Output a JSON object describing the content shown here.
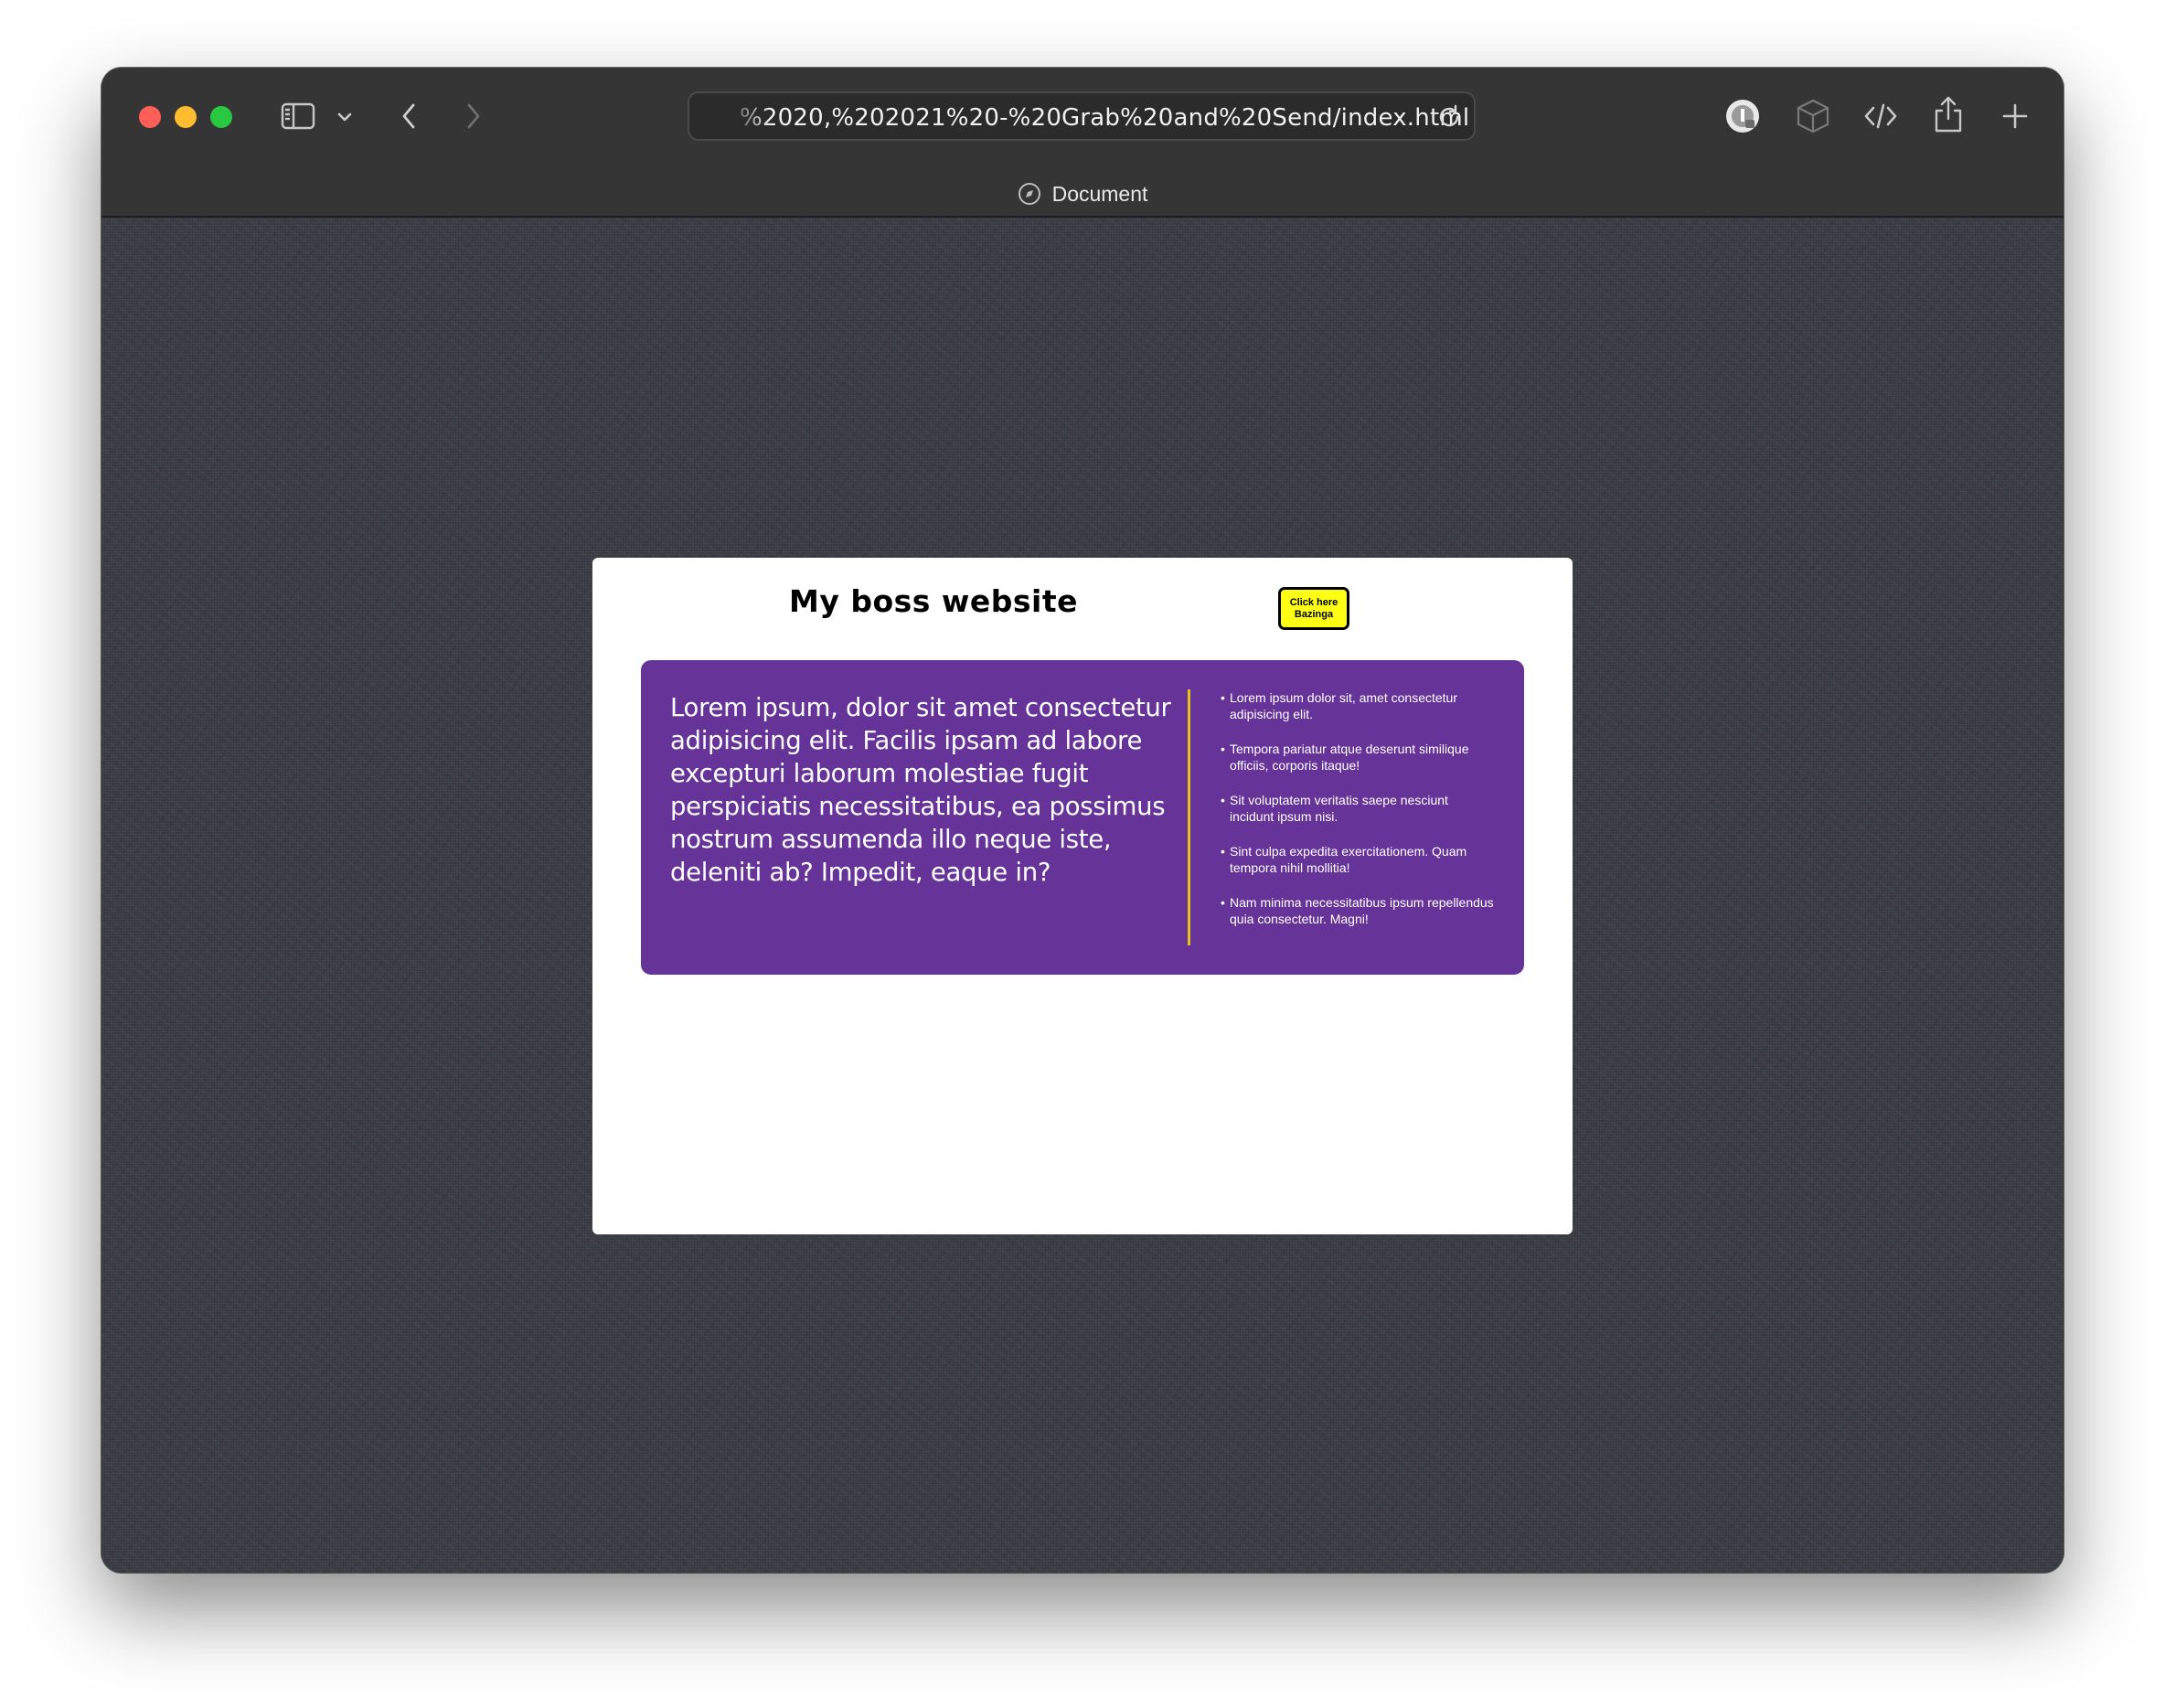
{
  "browser": {
    "url": "%2020,%202021%20-%20Grab%20and%20Send/index.html",
    "tab_title": "Document",
    "icons": [
      "sidebar-icon",
      "chevron-down-icon",
      "back-icon",
      "forward-icon",
      "reload-icon",
      "compass-icon",
      "password-extension-icon",
      "cube-icon",
      "code-icon",
      "share-icon",
      "plus-icon"
    ],
    "traffic_lights": {
      "close": "#ff5f57",
      "minimize": "#febc2e",
      "zoom": "#28c840"
    }
  },
  "site": {
    "title": "My boss website",
    "button": {
      "line1": "Click here",
      "line2": "Bazinga"
    },
    "card": {
      "paragraph": "Lorem ipsum, dolor sit amet consectetur adipisicing elit. Facilis ipsam ad labore excepturi laborum molestiae fugit perspiciatis necessitatibus, ea possimus nostrum assumenda illo neque iste, deleniti ab? Impedit, eaque in?",
      "list": [
        "Lorem ipsum dolor sit, amet consectetur adipisicing elit.",
        "Tempora pariatur atque deserunt similique officiis, corporis itaque!",
        "Sit voluptatem veritatis saepe nesciunt incidunt ipsum nisi.",
        "Sint culpa expedita exercitationem. Quam tempora nihil mollitia!",
        "Nam minima necessitatibus ipsum repellendus quia consectetur. Magni!"
      ]
    }
  },
  "colors": {
    "card_bg": "#663399",
    "button_bg": "#ffff14",
    "divider": "#e6c21a",
    "toolbar_bg": "#353536"
  }
}
